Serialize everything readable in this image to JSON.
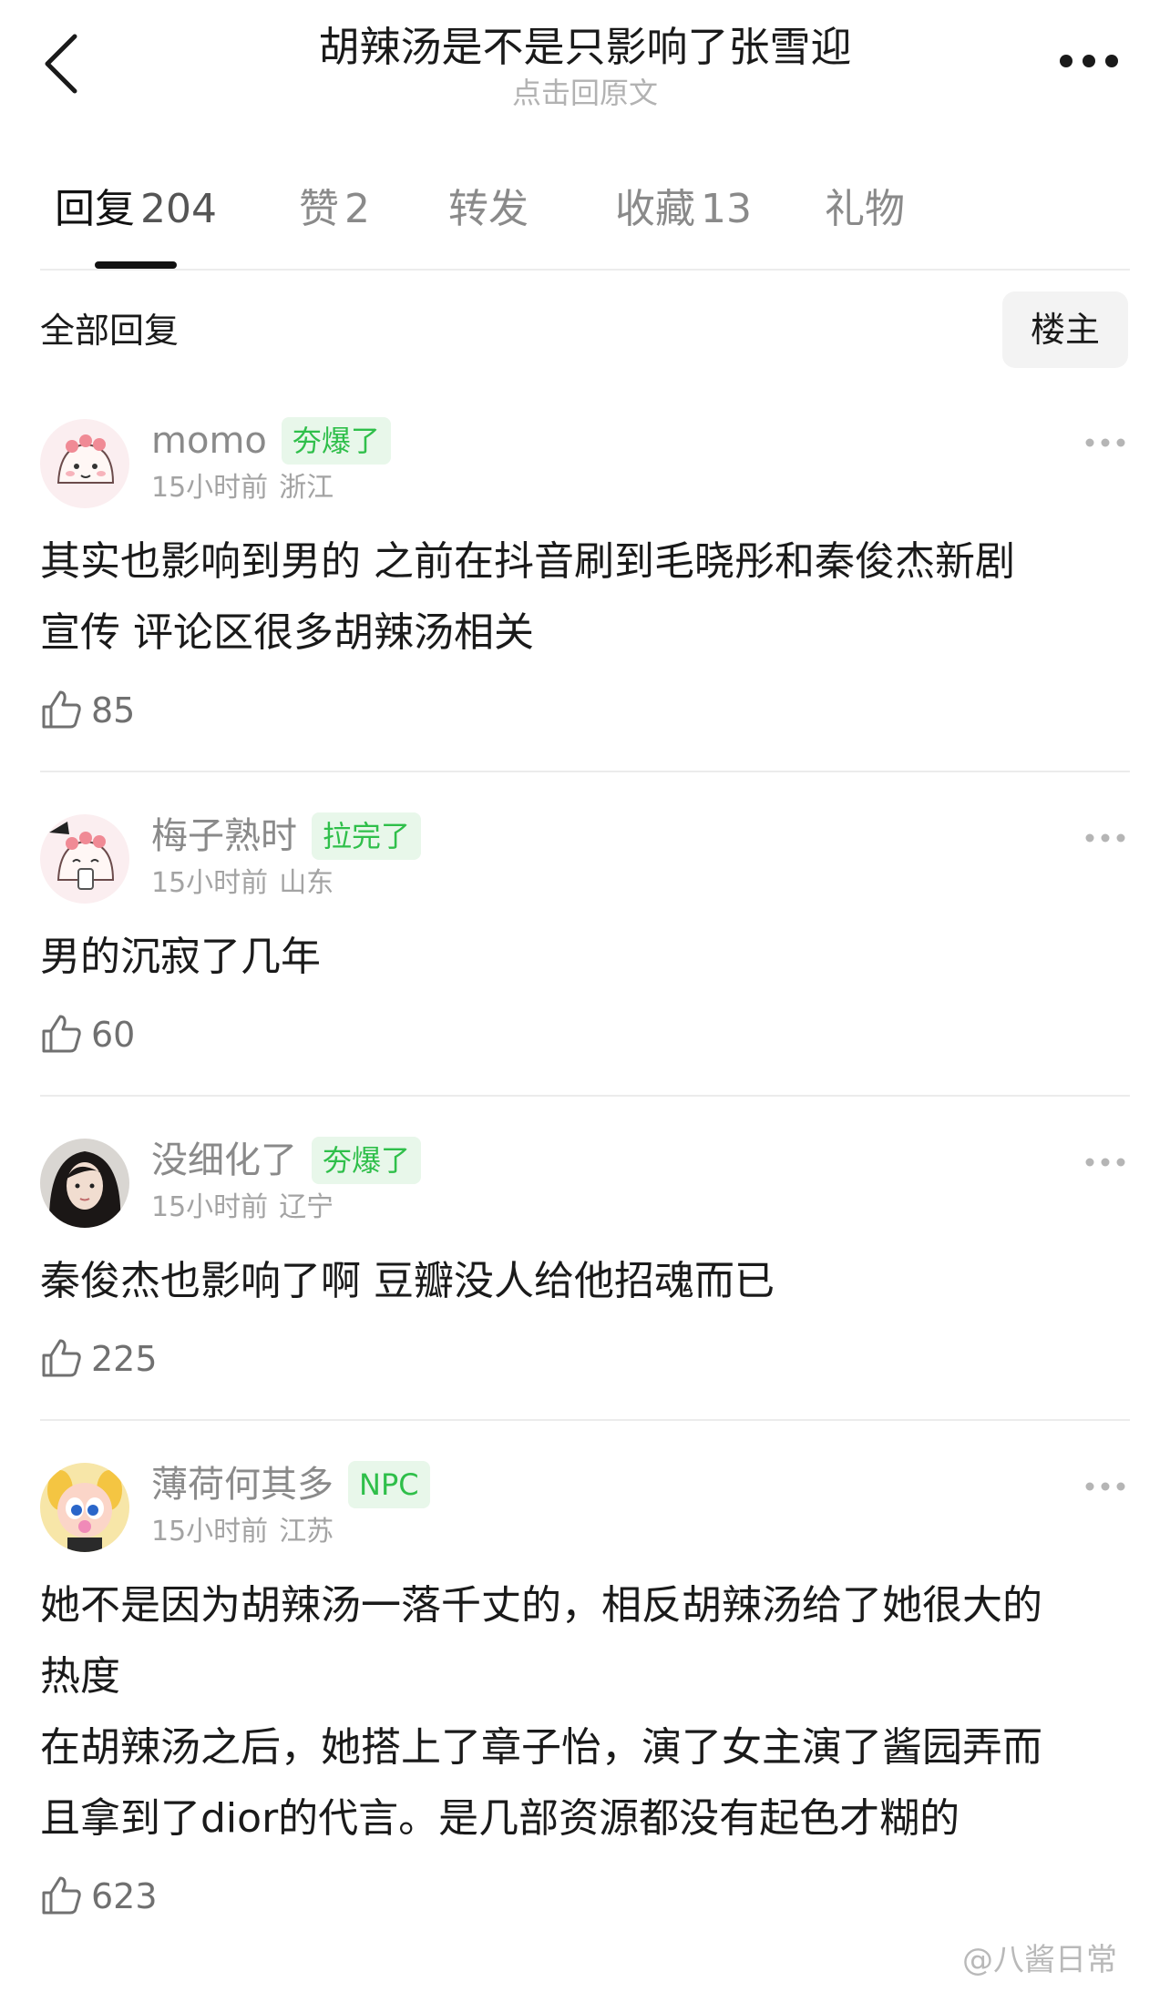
{
  "header": {
    "title": "胡辣汤是不是只影响了张雪迎",
    "subtitle": "点击回原文"
  },
  "tabs": [
    {
      "label": "回复",
      "count": "204"
    },
    {
      "label": "赞",
      "count": "2"
    },
    {
      "label": "转发",
      "count": ""
    },
    {
      "label": "收藏",
      "count": "13"
    },
    {
      "label": "礼物",
      "count": ""
    }
  ],
  "filter": {
    "label": "全部回复",
    "owner_button": "楼主"
  },
  "comments": [
    {
      "username": "momo",
      "badge": "夯爆了",
      "time": "15小时前",
      "location": "浙江",
      "text": "其实也影响到男的 之前在抖音刷到毛晓彤和秦俊杰新剧\n宣传 评论区很多胡辣汤相关",
      "likes": "85"
    },
    {
      "username": "梅子熟时",
      "badge": "拉完了",
      "time": "15小时前",
      "location": "山东",
      "text": "男的沉寂了几年",
      "likes": "60"
    },
    {
      "username": "没细化了",
      "badge": "夯爆了",
      "time": "15小时前",
      "location": "辽宁",
      "text": "秦俊杰也影响了啊 豆瓣没人给他招魂而已",
      "likes": "225"
    },
    {
      "username": "薄荷何其多",
      "badge": "NPC",
      "time": "15小时前",
      "location": "江苏",
      "text": "她不是因为胡辣汤一落千丈的，相反胡辣汤给了她很大的\n热度\n在胡辣汤之后，她搭上了章子怡，演了女主演了酱园弄而\n且拿到了dior的代言。是几部资源都没有起色才糊的",
      "likes": "623"
    }
  ],
  "watermark": "@八酱日常",
  "colors": {
    "badge_bg": "#e8f7ea",
    "badge_text": "#2fbf4a",
    "secondary_text": "#8a8a8a",
    "divider": "#ececec"
  }
}
